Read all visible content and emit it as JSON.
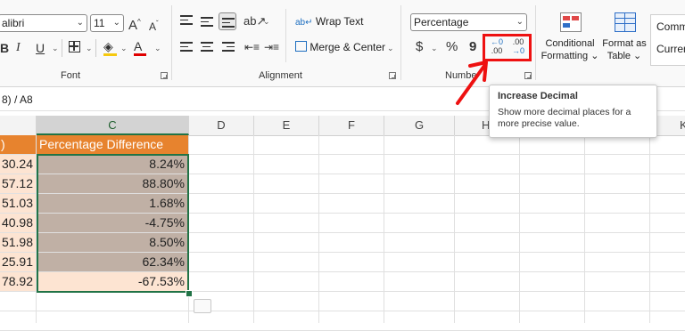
{
  "font_group": {
    "font_name": "alibri",
    "font_size": "11",
    "grow_font_label": "A",
    "shrink_font_label": "A",
    "bold_label": "B",
    "italic_label": "I",
    "underline_label": "U",
    "font_color_label": "A",
    "label": "Font",
    "font_color": "#e00000"
  },
  "alignment_group": {
    "wrap_text_label": "Wrap Text",
    "merge_center_label": "Merge & Center",
    "label": "Alignment"
  },
  "number_group": {
    "format_value": "Percentage",
    "currency_label": "$",
    "percent_label": "%",
    "comma_label": "9",
    "increase_decimal_top": "←0",
    "increase_decimal_bottom": ".00",
    "decrease_decimal_top": ".00",
    "decrease_decimal_bottom": "→0",
    "label": "Numbe"
  },
  "styles_group": {
    "conditional_formatting_line1": "Conditional",
    "conditional_formatting_line2": "Formatting",
    "format_as_table_line1": "Format as",
    "format_as_table_line2": "Table",
    "cell_style_1": "Comm",
    "cell_style_2": "Curren"
  },
  "tooltip": {
    "title": "Increase Decimal",
    "description": "Show more decimal places for a more precise value."
  },
  "formula_bar": {
    "content": "8) / A8"
  },
  "columns": {
    "b_partial": "",
    "c": "C",
    "d": "D",
    "e": "E",
    "f": "F",
    "g": "G",
    "h": "H",
    "k_partial": "K"
  },
  "table": {
    "header_b_partial": ")",
    "header_c": "Percentage Difference",
    "rows": [
      {
        "b": "30.24",
        "c": "8.24%"
      },
      {
        "b": "57.12",
        "c": "88.80%"
      },
      {
        "b": "51.03",
        "c": "1.68%"
      },
      {
        "b": "40.98",
        "c": "-4.75%"
      },
      {
        "b": "51.98",
        "c": "8.50%"
      },
      {
        "b": "25.91",
        "c": "62.34%"
      },
      {
        "b": "78.92",
        "c": "-67.53%"
      }
    ]
  },
  "colors": {
    "header_orange": "#e7832e",
    "selection_fill": "#c0b0a5",
    "light_peach": "#fde4d2",
    "annotation_red": "#ee1111",
    "excel_green": "#217346"
  }
}
